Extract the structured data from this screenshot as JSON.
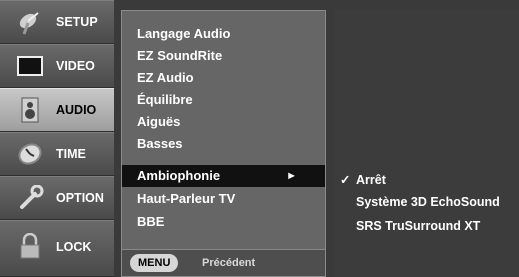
{
  "categories": [
    {
      "label": "SETUP",
      "icon": "satellite-dish-icon",
      "selected": false
    },
    {
      "label": "VIDEO",
      "icon": "monitor-icon",
      "selected": false
    },
    {
      "label": "AUDIO",
      "icon": "speaker-icon",
      "selected": true
    },
    {
      "label": "TIME",
      "icon": "clock-icon",
      "selected": false
    },
    {
      "label": "OPTION",
      "icon": "wrench-icon",
      "selected": false
    },
    {
      "label": "LOCK",
      "icon": "padlock-icon",
      "selected": false
    }
  ],
  "audio_menu": {
    "items": [
      "Langage Audio",
      "EZ SoundRite",
      "EZ Audio",
      "Équilibre",
      "Aiguës",
      "Basses",
      "Ambiophonie",
      "Haut-Parleur TV",
      "BBE"
    ],
    "active_index": 6,
    "active_arrow": "►"
  },
  "footer": {
    "menu_label": "MENU",
    "prev_label": "Précédent"
  },
  "options": {
    "check_mark": "✓",
    "items": [
      "Arrêt",
      "Système 3D EchoSound",
      "SRS TruSurround XT"
    ],
    "selected_index": 0
  },
  "colors": {
    "active_item": "#111111",
    "selected_category": "#b4b4b4"
  }
}
